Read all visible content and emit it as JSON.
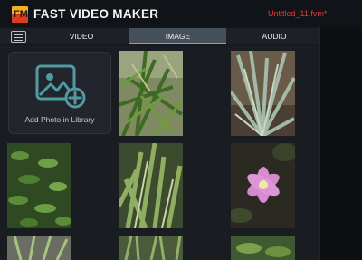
{
  "app": {
    "title": "FAST VIDEO MAKER",
    "logo_text": "FM",
    "file_name": "Untitled_11.fvm*"
  },
  "tabs": [
    {
      "label": "VIDEO",
      "active": false
    },
    {
      "label": "IMAGE",
      "active": true
    },
    {
      "label": "AUDIO",
      "active": false
    }
  ],
  "library": {
    "add_photo_label": "Add Photo in Library",
    "add_icon": "add-photo-icon",
    "photos": [
      {
        "subject": "palm fronds"
      },
      {
        "subject": "spiky agave plant"
      },
      {
        "subject": "leafy shrub"
      },
      {
        "subject": "aloe cluster"
      },
      {
        "subject": "pink lily flower"
      },
      {
        "subject": "spider plant"
      },
      {
        "subject": "grass blades"
      },
      {
        "subject": "green leaves"
      }
    ]
  },
  "colors": {
    "accent": "#6ba9d9",
    "active_tab": "#46505b",
    "file_name": "#e23a3a",
    "icon": "#4f9ba1"
  }
}
